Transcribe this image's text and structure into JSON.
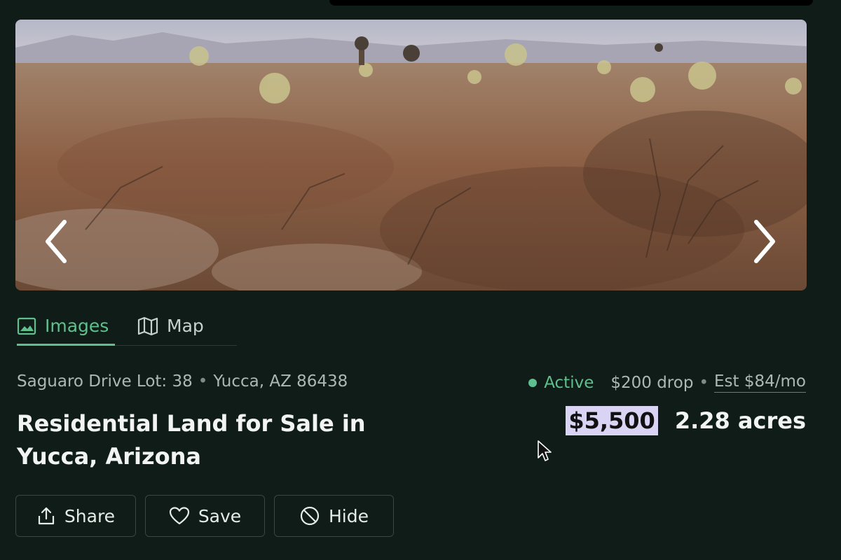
{
  "photo": {
    "alt_subject": "desert land with brush and cacti",
    "icons": {
      "prev": "chevron-left-icon",
      "next": "chevron-right-icon"
    }
  },
  "tabs": [
    {
      "label": "Images",
      "icon": "image-icon",
      "active": true
    },
    {
      "label": "Map",
      "icon": "map-icon",
      "active": false
    }
  ],
  "listing": {
    "street": "Saguaro Drive Lot: 38",
    "separator": "•",
    "city": "Yucca, AZ 86438",
    "title": "Residential Land for Sale in Yucca, Arizona",
    "status": "Active",
    "price_drop": "$200 drop",
    "status_separator": "•",
    "estimate": "Est $84/mo",
    "price": "$5,500",
    "acreage": "2.28 acres"
  },
  "actions": [
    {
      "label": "Share",
      "icon": "share-icon"
    },
    {
      "label": "Save",
      "icon": "heart-icon"
    },
    {
      "label": "Hide",
      "icon": "hide-icon"
    }
  ],
  "colors": {
    "background": "#0f1c17",
    "accent_green": "#5fc08e",
    "price_highlight": "#d9d3f4"
  }
}
